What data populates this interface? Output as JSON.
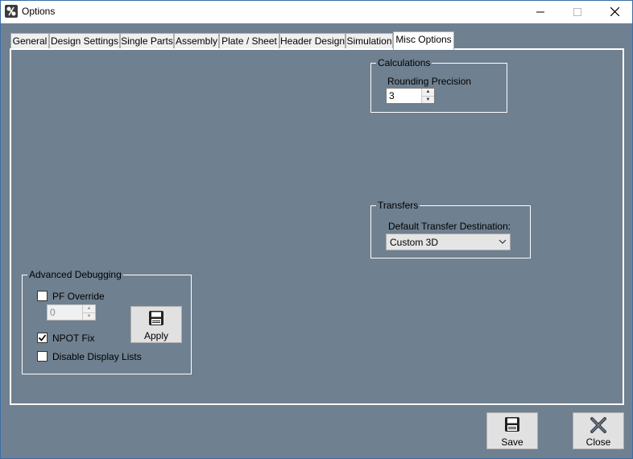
{
  "window": {
    "title": "Options",
    "minimize_icon": "minimize-icon",
    "maximize_icon": "maximize-icon",
    "close_icon": "close-icon"
  },
  "tabs": [
    {
      "label": "General",
      "active": false
    },
    {
      "label": "Design Settings",
      "active": false
    },
    {
      "label": "Single Parts",
      "active": false
    },
    {
      "label": "Assembly",
      "active": false
    },
    {
      "label": "Plate / Sheet",
      "active": false
    },
    {
      "label": "Header Design",
      "active": false
    },
    {
      "label": "Simulation",
      "active": false
    },
    {
      "label": "Misc Options",
      "active": true
    }
  ],
  "calculations": {
    "legend": "Calculations",
    "rounding_label": "Rounding Precision",
    "rounding_value": "3"
  },
  "transfers": {
    "legend": "Transfers",
    "destination_label": "Default Transfer Destination:",
    "destination_value": "Custom 3D"
  },
  "debugging": {
    "legend": "Advanced Debugging",
    "pf_override_label": "PF Override",
    "pf_override_checked": false,
    "pf_value": "0",
    "npot_label": "NPOT Fix",
    "npot_checked": true,
    "disable_lists_label": "Disable Display Lists",
    "disable_lists_checked": false,
    "apply_label": "Apply"
  },
  "footer": {
    "save_label": "Save",
    "close_label": "Close"
  },
  "colors": {
    "background": "#6f8090",
    "panel_border": "#ffffff"
  }
}
